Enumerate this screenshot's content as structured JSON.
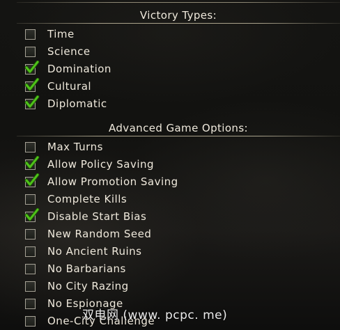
{
  "victory_section": {
    "title": "Victory Types:",
    "options": [
      {
        "label": "Time",
        "checked": false
      },
      {
        "label": "Science",
        "checked": false
      },
      {
        "label": "Domination",
        "checked": true
      },
      {
        "label": "Cultural",
        "checked": true
      },
      {
        "label": "Diplomatic",
        "checked": true
      }
    ]
  },
  "advanced_section": {
    "title": "Advanced Game Options:",
    "options": [
      {
        "label": "Max Turns",
        "checked": false
      },
      {
        "label": "Allow Policy Saving",
        "checked": true
      },
      {
        "label": "Allow Promotion Saving",
        "checked": true
      },
      {
        "label": "Complete Kills",
        "checked": false
      },
      {
        "label": "Disable Start Bias",
        "checked": true
      },
      {
        "label": "New Random Seed",
        "checked": false
      },
      {
        "label": "No Ancient Ruins",
        "checked": false
      },
      {
        "label": "No Barbarians",
        "checked": false
      },
      {
        "label": "No City Razing",
        "checked": false
      },
      {
        "label": "No Espionage",
        "checked": false
      },
      {
        "label": "One-City Challenge",
        "checked": false
      }
    ]
  },
  "watermark": "双电网 (www. pcpc. me)",
  "colors": {
    "check_green": "#4fc21a",
    "text": "#efe9dc",
    "box_border": "#a6a296"
  }
}
